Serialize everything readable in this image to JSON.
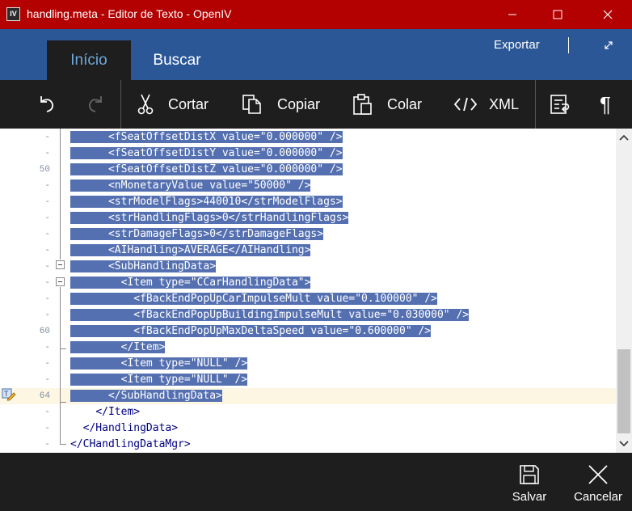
{
  "window": {
    "title": "handling.meta - Editor de Texto - OpenIV",
    "app_icon_text": "IV"
  },
  "ribbon": {
    "tabs": [
      {
        "label": "Início",
        "active": true
      },
      {
        "label": "Buscar",
        "active": false
      }
    ],
    "export_label": "Exportar"
  },
  "toolbar": {
    "cut_label": "Cortar",
    "copy_label": "Copiar",
    "paste_label": "Colar",
    "xml_label": "XML",
    "paragraph_glyph": "¶"
  },
  "editor": {
    "lines": [
      {
        "ln": "-",
        "indent": "      ",
        "text": "<fSeatOffsetDistX value=\"0.000000\" />",
        "selected": true
      },
      {
        "ln": "-",
        "indent": "      ",
        "text": "<fSeatOffsetDistY value=\"0.000000\" />",
        "selected": true
      },
      {
        "ln": "50",
        "indent": "      ",
        "text": "<fSeatOffsetDistZ value=\"0.000000\" />",
        "selected": true
      },
      {
        "ln": "-",
        "indent": "      ",
        "text": "<nMonetaryValue value=\"50000\" />",
        "selected": true
      },
      {
        "ln": "-",
        "indent": "      ",
        "text": "<strModelFlags>440010</strModelFlags>",
        "selected": true
      },
      {
        "ln": "-",
        "indent": "      ",
        "text": "<strHandlingFlags>0</strHandlingFlags>",
        "selected": true
      },
      {
        "ln": "-",
        "indent": "      ",
        "text": "<strDamageFlags>0</strDamageFlags>",
        "selected": true
      },
      {
        "ln": "-",
        "indent": "      ",
        "text": "<AIHandling>AVERAGE</AIHandling>",
        "selected": true
      },
      {
        "ln": "-",
        "indent": "      ",
        "text": "<SubHandlingData>",
        "selected": true
      },
      {
        "ln": "-",
        "indent": "        ",
        "text": "<Item type=\"CCarHandlingData\">",
        "selected": true
      },
      {
        "ln": "-",
        "indent": "          ",
        "text": "<fBackEndPopUpCarImpulseMult value=\"0.100000\" />",
        "selected": true
      },
      {
        "ln": "-",
        "indent": "          ",
        "text": "<fBackEndPopUpBuildingImpulseMult value=\"0.030000\" />",
        "selected": true
      },
      {
        "ln": "60",
        "indent": "          ",
        "text": "<fBackEndPopUpMaxDeltaSpeed value=\"0.600000\" />",
        "selected": true
      },
      {
        "ln": "-",
        "indent": "        ",
        "text": "</Item>",
        "selected": true
      },
      {
        "ln": "-",
        "indent": "        ",
        "text": "<Item type=\"NULL\" />",
        "selected": true
      },
      {
        "ln": "-",
        "indent": "        ",
        "text": "<Item type=\"NULL\" />",
        "selected": true
      },
      {
        "ln": "64",
        "indent": "      ",
        "text": "</SubHandlingData>",
        "selected": true
      },
      {
        "ln": "-",
        "indent": "    ",
        "text": "</Item>",
        "selected": false
      },
      {
        "ln": "-",
        "indent": "  ",
        "text": "</HandlingData>",
        "selected": false
      },
      {
        "ln": "-",
        "indent": "",
        "text": "</CHandlingDataMgr>",
        "selected": false
      }
    ]
  },
  "bottombar": {
    "save_label": "Salvar",
    "cancel_label": "Cancelar"
  },
  "colors": {
    "titlebar": "#b30000",
    "ribbon": "#2b5797",
    "selection": "#5570b0",
    "current_line": "#fdf6e3"
  }
}
